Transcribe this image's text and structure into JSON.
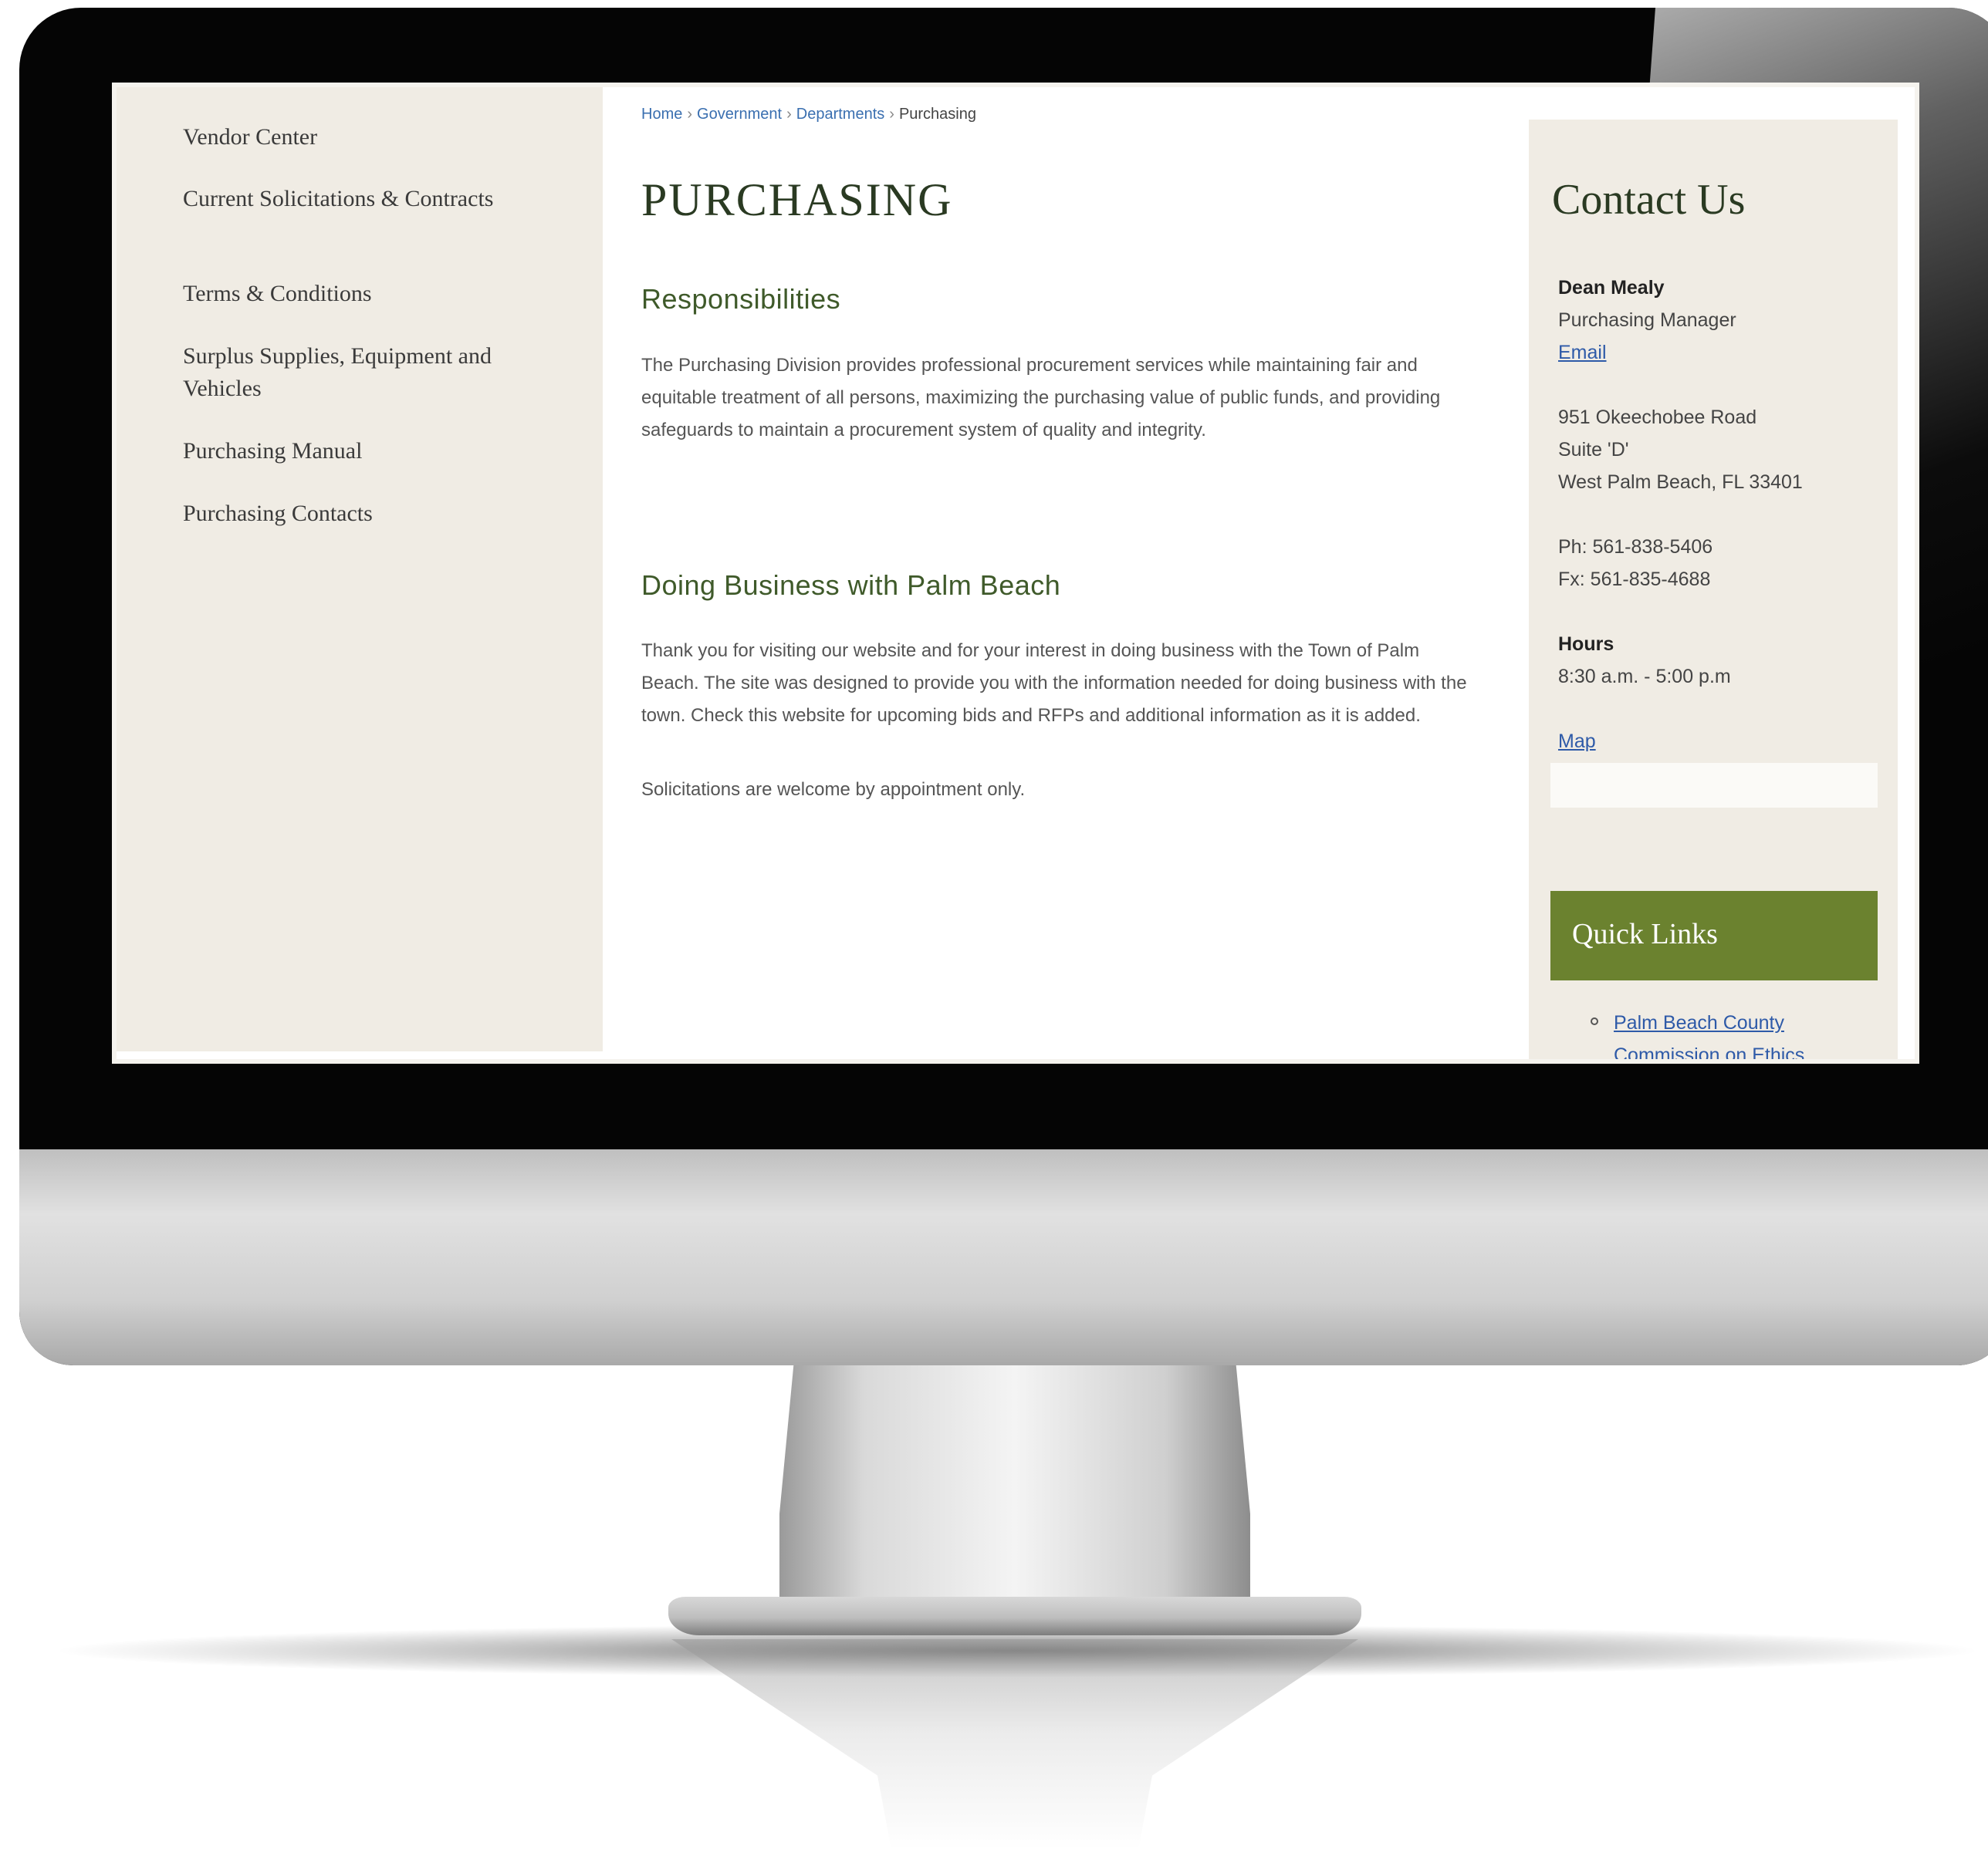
{
  "breadcrumb": {
    "home": "Home",
    "government": "Government",
    "departments": "Departments",
    "current": "Purchasing",
    "separator": "›"
  },
  "sidebar": {
    "items": [
      {
        "label": "Vendor Center"
      },
      {
        "label": "Current Solicitations & Contracts"
      },
      {
        "label": "Terms & Conditions"
      },
      {
        "label": "Surplus Supplies, Equipment and Vehicles"
      },
      {
        "label": "Purchasing Manual"
      },
      {
        "label": "Purchasing Contacts"
      }
    ]
  },
  "main": {
    "title": "PURCHASING",
    "sections": [
      {
        "heading": "Responsibilities",
        "paragraphs": [
          "The Purchasing Division provides professional procurement services while maintaining fair and equitable treatment of all persons, maximizing the purchasing value of public funds, and providing safeguards to maintain a procurement system of quality and integrity."
        ]
      },
      {
        "heading": "Doing Business with Palm Beach",
        "paragraphs": [
          "Thank you for visiting our website and for your interest in doing business with the Town of Palm Beach. The site was designed to provide you with the information needed for doing business with the town. Check this website for upcoming bids and RFPs and additional information as it is added.",
          "Solicitations are welcome by appointment only."
        ]
      }
    ]
  },
  "contact": {
    "title": "Contact Us",
    "name": "Dean Mealy",
    "role": "Purchasing Manager",
    "email_link": "Email",
    "address_line1": "951 Okeechobee Road",
    "address_line2": "Suite 'D'",
    "address_line3": "West Palm Beach, FL 33401",
    "phone": "Ph: 561-838-5406",
    "fax": "Fx:  561-835-4688",
    "hours_label": "Hours",
    "hours_value": "8:30 a.m. - 5:00 p.m",
    "map_link": "Map"
  },
  "quick_links": {
    "title": "Quick Links",
    "items": [
      {
        "label": "Palm Beach County Commission on Ethics"
      }
    ]
  },
  "colors": {
    "sidebar_bg": "#f0ece4",
    "quicklinks_header_bg": "#6b822f",
    "heading_green": "#3f5a2a",
    "link_blue": "#2e5aa8"
  }
}
